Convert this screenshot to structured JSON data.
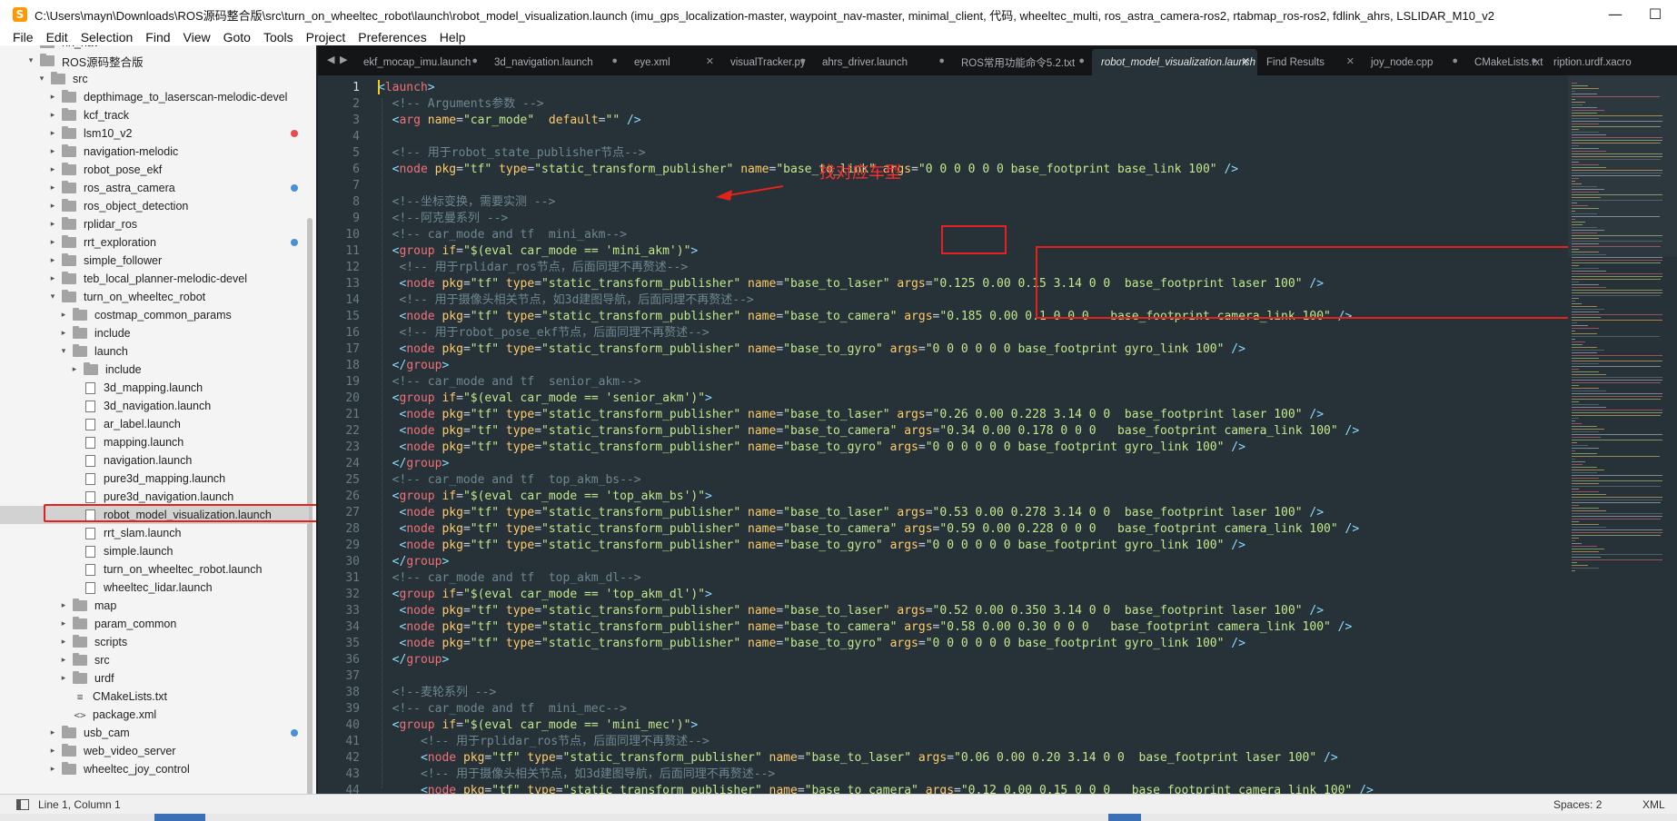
{
  "window": {
    "title": "C:\\Users\\mayn\\Downloads\\ROS源码整合版\\src\\turn_on_wheeltec_robot\\launch\\robot_model_visualization.launch (imu_gps_localization-master, waypoint_nav-master, minimal_client, 代码, wheeltec_multi, ros_astra_camera-ros2, rtabmap_ros-ros2, fdlink_ahrs, LSLIDAR_M10_v2",
    "minimize": "—",
    "maximize": "☐"
  },
  "menu": [
    "File",
    "Edit",
    "Selection",
    "Find",
    "View",
    "Goto",
    "Tools",
    "Project",
    "Preferences",
    "Help"
  ],
  "sidebar": {
    "items": [
      {
        "label": "hn_nav",
        "type": "folder",
        "depth": 1,
        "arrow": "▸"
      },
      {
        "label": "ROS源码整合版",
        "type": "folder",
        "depth": 1,
        "arrow": "▾"
      },
      {
        "label": "src",
        "type": "folder",
        "depth": 2,
        "arrow": "▾"
      },
      {
        "label": "depthimage_to_laserscan-melodic-devel",
        "type": "folder",
        "depth": 3,
        "arrow": "▸"
      },
      {
        "label": "kcf_track",
        "type": "folder",
        "depth": 3,
        "arrow": "▸"
      },
      {
        "label": "lsm10_v2",
        "type": "folder",
        "depth": 3,
        "arrow": "▸",
        "dot": "#e84c4c"
      },
      {
        "label": "navigation-melodic",
        "type": "folder",
        "depth": 3,
        "arrow": "▸"
      },
      {
        "label": "robot_pose_ekf",
        "type": "folder",
        "depth": 3,
        "arrow": "▸"
      },
      {
        "label": "ros_astra_camera",
        "type": "folder",
        "depth": 3,
        "arrow": "▸",
        "dot": "#4a90d9"
      },
      {
        "label": "ros_object_detection",
        "type": "folder",
        "depth": 3,
        "arrow": "▸"
      },
      {
        "label": "rplidar_ros",
        "type": "folder",
        "depth": 3,
        "arrow": "▸"
      },
      {
        "label": "rrt_exploration",
        "type": "folder",
        "depth": 3,
        "arrow": "▸",
        "dot": "#4a90d9"
      },
      {
        "label": "simple_follower",
        "type": "folder",
        "depth": 3,
        "arrow": "▸"
      },
      {
        "label": "teb_local_planner-melodic-devel",
        "type": "folder",
        "depth": 3,
        "arrow": "▸"
      },
      {
        "label": "turn_on_wheeltec_robot",
        "type": "folder",
        "depth": 3,
        "arrow": "▾"
      },
      {
        "label": "costmap_common_params",
        "type": "folder",
        "depth": 4,
        "arrow": "▸"
      },
      {
        "label": "include",
        "type": "folder",
        "depth": 4,
        "arrow": "▸"
      },
      {
        "label": "launch",
        "type": "folder",
        "depth": 4,
        "arrow": "▾"
      },
      {
        "label": "include",
        "type": "folder",
        "depth": 5,
        "arrow": "▸"
      },
      {
        "label": "3d_mapping.launch",
        "type": "file",
        "depth": 5
      },
      {
        "label": "3d_navigation.launch",
        "type": "file",
        "depth": 5
      },
      {
        "label": "ar_label.launch",
        "type": "file",
        "depth": 5
      },
      {
        "label": "mapping.launch",
        "type": "file",
        "depth": 5
      },
      {
        "label": "navigation.launch",
        "type": "file",
        "depth": 5
      },
      {
        "label": "pure3d_mapping.launch",
        "type": "file",
        "depth": 5
      },
      {
        "label": "pure3d_navigation.launch",
        "type": "file",
        "depth": 5
      },
      {
        "label": "robot_model_visualization.launch",
        "type": "file",
        "depth": 5,
        "selected": true
      },
      {
        "label": "rrt_slam.launch",
        "type": "file",
        "depth": 5
      },
      {
        "label": "simple.launch",
        "type": "file",
        "depth": 5
      },
      {
        "label": "turn_on_wheeltec_robot.launch",
        "type": "file",
        "depth": 5
      },
      {
        "label": "wheeltec_lidar.launch",
        "type": "file",
        "depth": 5
      },
      {
        "label": "map",
        "type": "folder",
        "depth": 4,
        "arrow": "▸"
      },
      {
        "label": "param_common",
        "type": "folder",
        "depth": 4,
        "arrow": "▸"
      },
      {
        "label": "scripts",
        "type": "folder",
        "depth": 4,
        "arrow": "▸"
      },
      {
        "label": "src",
        "type": "folder",
        "depth": 4,
        "arrow": "▸"
      },
      {
        "label": "urdf",
        "type": "folder",
        "depth": 4,
        "arrow": "▸"
      },
      {
        "label": "CMakeLists.txt",
        "type": "text",
        "depth": 4,
        "glyph": "≡"
      },
      {
        "label": "package.xml",
        "type": "text",
        "depth": 4,
        "glyph": "<>"
      },
      {
        "label": "usb_cam",
        "type": "folder",
        "depth": 3,
        "arrow": "▸",
        "dot": "#4a90d9"
      },
      {
        "label": "web_video_server",
        "type": "folder",
        "depth": 3,
        "arrow": "▸"
      },
      {
        "label": "wheeltec_joy_control",
        "type": "folder",
        "depth": 3,
        "arrow": "▸"
      }
    ]
  },
  "tabs": [
    {
      "label": "ekf_mocap_imu.launch",
      "close": "●"
    },
    {
      "label": "3d_navigation.launch",
      "close": "●"
    },
    {
      "label": "eye.xml",
      "close": "✕"
    },
    {
      "label": "visualTracker.py",
      "close": "●"
    },
    {
      "label": "ahrs_driver.launch",
      "close": "●"
    },
    {
      "label": "ROS常用功能命令5.2.txt",
      "close": "●"
    },
    {
      "label": "robot_model_visualization.launch",
      "close": "✕",
      "active": true
    },
    {
      "label": "Find Results",
      "close": "✕"
    },
    {
      "label": "joy_node.cpp",
      "close": "●"
    },
    {
      "label": "CMakeLists.txt",
      "close": "●"
    },
    {
      "label": "ription.urdf.xacro",
      "close": ""
    }
  ],
  "tab_nav": {
    "left": "◀",
    "right": "▶"
  },
  "code": [
    "<launch>",
    "  <!-- Arguments参数 -->",
    "  <arg name=\"car_mode\"  default=\"\" />",
    "",
    "  <!-- 用于robot_state_publisher节点-->",
    "  <node pkg=\"tf\" type=\"static_transform_publisher\" name=\"base_to_link\" args=\"0 0 0 0 0 0 base_footprint base_link 100\" />",
    "",
    "  <!--坐标变换，需要实测 -->",
    "  <!--阿克曼系列 -->",
    "  <!-- car_mode and tf  mini_akm-->",
    "  <group if=\"$(eval car_mode == 'mini_akm')\">",
    "   <!-- 用于rplidar_ros节点，后面同理不再赘述-->",
    "   <node pkg=\"tf\" type=\"static_transform_publisher\" name=\"base_to_laser\" args=\"0.125 0.00 0.15 3.14 0 0  base_footprint laser 100\" />",
    "   <!-- 用于摄像头相关节点，如3d建图导航，后面同理不再赘述-->",
    "   <node pkg=\"tf\" type=\"static_transform_publisher\" name=\"base_to_camera\" args=\"0.185 0.00 0.1 0 0 0   base_footprint camera_link 100\" />",
    "   <!-- 用于robot_pose_ekf节点，后面同理不再赘述-->",
    "   <node pkg=\"tf\" type=\"static_transform_publisher\" name=\"base_to_gyro\" args=\"0 0 0 0 0 0 base_footprint gyro_link 100\" />",
    "  </group>",
    "  <!-- car_mode and tf  senior_akm-->",
    "  <group if=\"$(eval car_mode == 'senior_akm')\">",
    "   <node pkg=\"tf\" type=\"static_transform_publisher\" name=\"base_to_laser\" args=\"0.26 0.00 0.228 3.14 0 0  base_footprint laser 100\" />",
    "   <node pkg=\"tf\" type=\"static_transform_publisher\" name=\"base_to_camera\" args=\"0.34 0.00 0.178 0 0 0   base_footprint camera_link 100\" />",
    "   <node pkg=\"tf\" type=\"static_transform_publisher\" name=\"base_to_gyro\" args=\"0 0 0 0 0 0 base_footprint gyro_link 100\" />",
    "  </group>",
    "  <!-- car_mode and tf  top_akm_bs-->",
    "  <group if=\"$(eval car_mode == 'top_akm_bs')\">",
    "   <node pkg=\"tf\" type=\"static_transform_publisher\" name=\"base_to_laser\" args=\"0.53 0.00 0.278 3.14 0 0  base_footprint laser 100\" />",
    "   <node pkg=\"tf\" type=\"static_transform_publisher\" name=\"base_to_camera\" args=\"0.59 0.00 0.228 0 0 0   base_footprint camera_link 100\" />",
    "   <node pkg=\"tf\" type=\"static_transform_publisher\" name=\"base_to_gyro\" args=\"0 0 0 0 0 0 base_footprint gyro_link 100\" />",
    "  </group>",
    "  <!-- car_mode and tf  top_akm_dl-->",
    "  <group if=\"$(eval car_mode == 'top_akm_dl')\">",
    "   <node pkg=\"tf\" type=\"static_transform_publisher\" name=\"base_to_laser\" args=\"0.52 0.00 0.350 3.14 0 0  base_footprint laser 100\" />",
    "   <node pkg=\"tf\" type=\"static_transform_publisher\" name=\"base_to_camera\" args=\"0.58 0.00 0.30 0 0 0   base_footprint camera_link 100\" />",
    "   <node pkg=\"tf\" type=\"static_transform_publisher\" name=\"base_to_gyro\" args=\"0 0 0 0 0 0 base_footprint gyro_link 100\" />",
    "  </group>",
    "",
    "  <!--麦轮系列 -->",
    "  <!-- car_mode and tf  mini_mec-->",
    "  <group if=\"$(eval car_mode == 'mini_mec')\">",
    "      <!-- 用于rplidar_ros节点，后面同理不再赘述-->",
    "      <node pkg=\"tf\" type=\"static_transform_publisher\" name=\"base_to_laser\" args=\"0.06 0.00 0.20 3.14 0 0  base_footprint laser 100\" />",
    "      <!-- 用于摄像头相关节点，如3d建图导航，后面同理不再赘述-->",
    "      <node pkg=\"tf\" type=\"static_transform_publisher\" name=\"base_to_camera\" args=\"0.12 0.00 0.15 0 0 0   base_footprint camera_link 100\" />"
  ],
  "annotation": {
    "text": "找对应车型"
  },
  "status": {
    "position": "Line 1, Column 1",
    "spaces": "Spaces: 2",
    "syntax": "XML"
  },
  "colors": {
    "accent_annotation": "#e3231b",
    "editor_bg": "#263238",
    "tag": "#f07178",
    "attr": "#ffcb6b",
    "string": "#c3e88d",
    "comment": "#6f8790"
  }
}
